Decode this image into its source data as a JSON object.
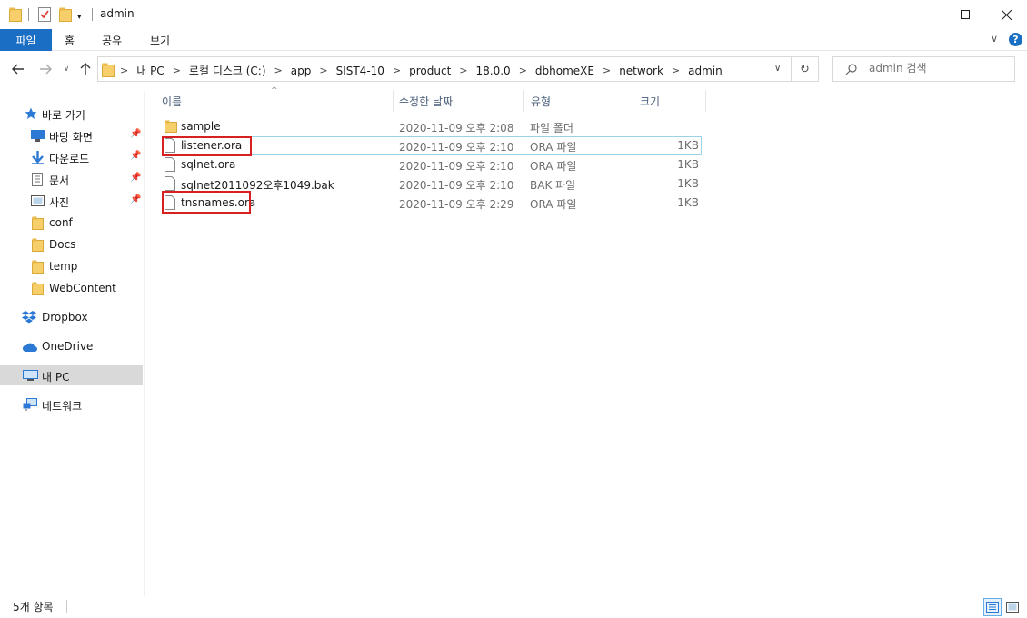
{
  "window": {
    "title": "admin"
  },
  "ribbon": {
    "file_tab": "파일",
    "tabs": [
      "홈",
      "공유",
      "보기"
    ]
  },
  "address": {
    "crumbs": [
      "내 PC",
      "로컬 디스크 (C:)",
      "app",
      "SIST4-10",
      "product",
      "18.0.0",
      "dbhomeXE",
      "network",
      "admin"
    ]
  },
  "search": {
    "placeholder": "admin 검색"
  },
  "sidebar": {
    "quick_access": "바로 가기",
    "pinned": [
      {
        "label": "바탕 화면",
        "icon": "desktop-icon"
      },
      {
        "label": "다운로드",
        "icon": "download-icon"
      },
      {
        "label": "문서",
        "icon": "document-icon"
      },
      {
        "label": "사진",
        "icon": "pictures-icon"
      }
    ],
    "folders": [
      "conf",
      "Docs",
      "temp",
      "WebContent"
    ],
    "dropbox": "Dropbox",
    "onedrive": "OneDrive",
    "this_pc": "내 PC",
    "network": "네트워크"
  },
  "columns": {
    "name": "이름",
    "modified": "수정한 날짜",
    "type": "유형",
    "size": "크기"
  },
  "files": [
    {
      "name": "sample",
      "modified": "2020-11-09 오후 2:08",
      "type": "파일 폴더",
      "size": "",
      "kind": "folder"
    },
    {
      "name": "listener.ora",
      "modified": "2020-11-09 오후 2:10",
      "type": "ORA 파일",
      "size": "1KB",
      "kind": "file"
    },
    {
      "name": "sqlnet.ora",
      "modified": "2020-11-09 오후 2:10",
      "type": "ORA 파일",
      "size": "1KB",
      "kind": "file"
    },
    {
      "name": "sqlnet2011092오후1049.bak",
      "modified": "2020-11-09 오후 2:10",
      "type": "BAK 파일",
      "size": "1KB",
      "kind": "file"
    },
    {
      "name": "tnsnames.ora",
      "modified": "2020-11-09 오후 2:29",
      "type": "ORA 파일",
      "size": "1KB",
      "kind": "file"
    }
  ],
  "status": {
    "item_count": "5개 항목"
  },
  "colors": {
    "accent": "#1a6fc4",
    "folder": "#f7cf6a",
    "highlight_box": "#d92020",
    "selection_border": "#99d1ea"
  }
}
